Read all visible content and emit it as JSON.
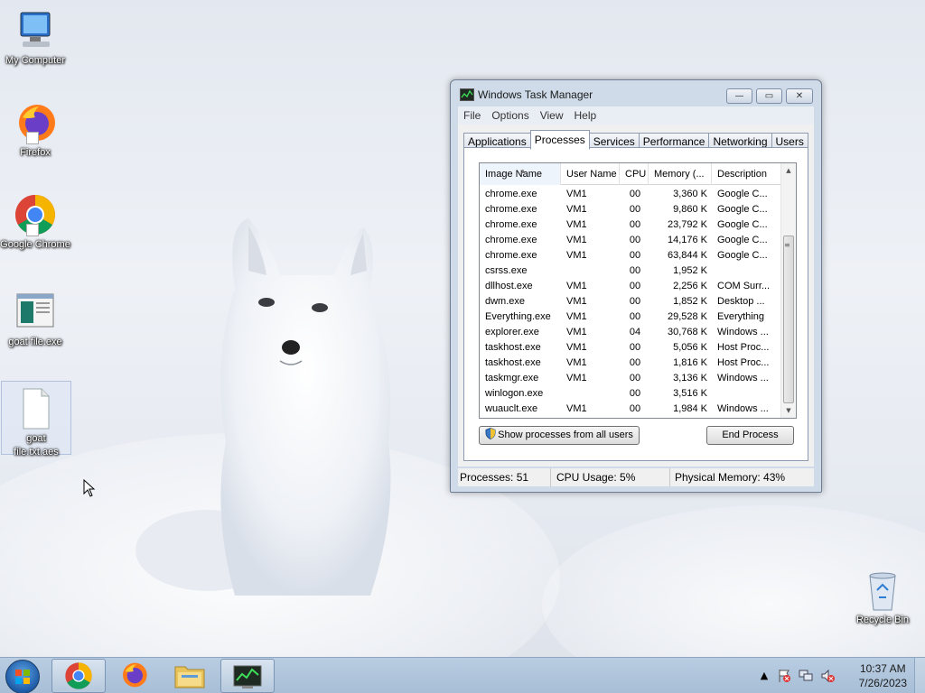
{
  "desktop": {
    "icons": [
      {
        "label": "My Computer",
        "icon": "computer-icon"
      },
      {
        "label": "Firefox",
        "icon": "firefox-icon"
      },
      {
        "label": "Google Chrome",
        "icon": "chrome-icon"
      },
      {
        "label": "goat file.exe",
        "icon": "exe-icon"
      },
      {
        "label": "goat file.txt.aes",
        "icon": "document-icon"
      },
      {
        "label": "Recycle Bin",
        "icon": "recycle-bin-icon"
      }
    ]
  },
  "task_manager": {
    "title": "Windows Task Manager",
    "controls": {
      "minimize": "—",
      "maximize": "▭",
      "close": "✕"
    },
    "menu": [
      "File",
      "Options",
      "View",
      "Help"
    ],
    "tabs": [
      {
        "label": "Applications",
        "active": false
      },
      {
        "label": "Processes",
        "active": true
      },
      {
        "label": "Services",
        "active": false
      },
      {
        "label": "Performance",
        "active": false
      },
      {
        "label": "Networking",
        "active": false
      },
      {
        "label": "Users",
        "active": false
      }
    ],
    "columns": [
      "Image Name",
      "User Name",
      "CPU",
      "Memory (...",
      "Description"
    ],
    "processes": [
      {
        "name": "chrome.exe",
        "user": "VM1",
        "cpu": "00",
        "memory": "3,360 K",
        "description": "Google C..."
      },
      {
        "name": "chrome.exe",
        "user": "VM1",
        "cpu": "00",
        "memory": "9,860 K",
        "description": "Google C..."
      },
      {
        "name": "chrome.exe",
        "user": "VM1",
        "cpu": "00",
        "memory": "23,792 K",
        "description": "Google C..."
      },
      {
        "name": "chrome.exe",
        "user": "VM1",
        "cpu": "00",
        "memory": "14,176 K",
        "description": "Google C..."
      },
      {
        "name": "chrome.exe",
        "user": "VM1",
        "cpu": "00",
        "memory": "63,844 K",
        "description": "Google C..."
      },
      {
        "name": "csrss.exe",
        "user": "",
        "cpu": "00",
        "memory": "1,952 K",
        "description": ""
      },
      {
        "name": "dllhost.exe",
        "user": "VM1",
        "cpu": "00",
        "memory": "2,256 K",
        "description": "COM Surr..."
      },
      {
        "name": "dwm.exe",
        "user": "VM1",
        "cpu": "00",
        "memory": "1,852 K",
        "description": "Desktop ..."
      },
      {
        "name": "Everything.exe",
        "user": "VM1",
        "cpu": "00",
        "memory": "29,528 K",
        "description": "Everything"
      },
      {
        "name": "explorer.exe",
        "user": "VM1",
        "cpu": "04",
        "memory": "30,768 K",
        "description": "Windows ..."
      },
      {
        "name": "taskhost.exe",
        "user": "VM1",
        "cpu": "00",
        "memory": "5,056 K",
        "description": "Host Proc..."
      },
      {
        "name": "taskhost.exe",
        "user": "VM1",
        "cpu": "00",
        "memory": "1,816 K",
        "description": "Host Proc..."
      },
      {
        "name": "taskmgr.exe",
        "user": "VM1",
        "cpu": "00",
        "memory": "3,136 K",
        "description": "Windows ..."
      },
      {
        "name": "winlogon.exe",
        "user": "",
        "cpu": "00",
        "memory": "3,516 K",
        "description": ""
      },
      {
        "name": "wuauclt.exe",
        "user": "VM1",
        "cpu": "00",
        "memory": "1,984 K",
        "description": "Windows ..."
      }
    ],
    "buttons": {
      "show_all": "Show processes from all users",
      "end_process": "End Process"
    },
    "status": {
      "processes": "Processes: 51",
      "cpu": "CPU Usage: 5%",
      "memory": "Physical Memory: 43%"
    }
  },
  "taskbar": {
    "pinned": [
      {
        "icon": "chrome-icon",
        "running": true
      },
      {
        "icon": "firefox-icon",
        "running": false
      },
      {
        "icon": "folder-icon",
        "running": false
      },
      {
        "icon": "task-manager-icon",
        "running": true
      }
    ],
    "tray_icons": [
      "show-hidden-icons-icon",
      "action-center-icon",
      "network-icon",
      "volume-muted-icon"
    ],
    "clock": {
      "time": "10:37 AM",
      "date": "7/26/2023"
    }
  }
}
